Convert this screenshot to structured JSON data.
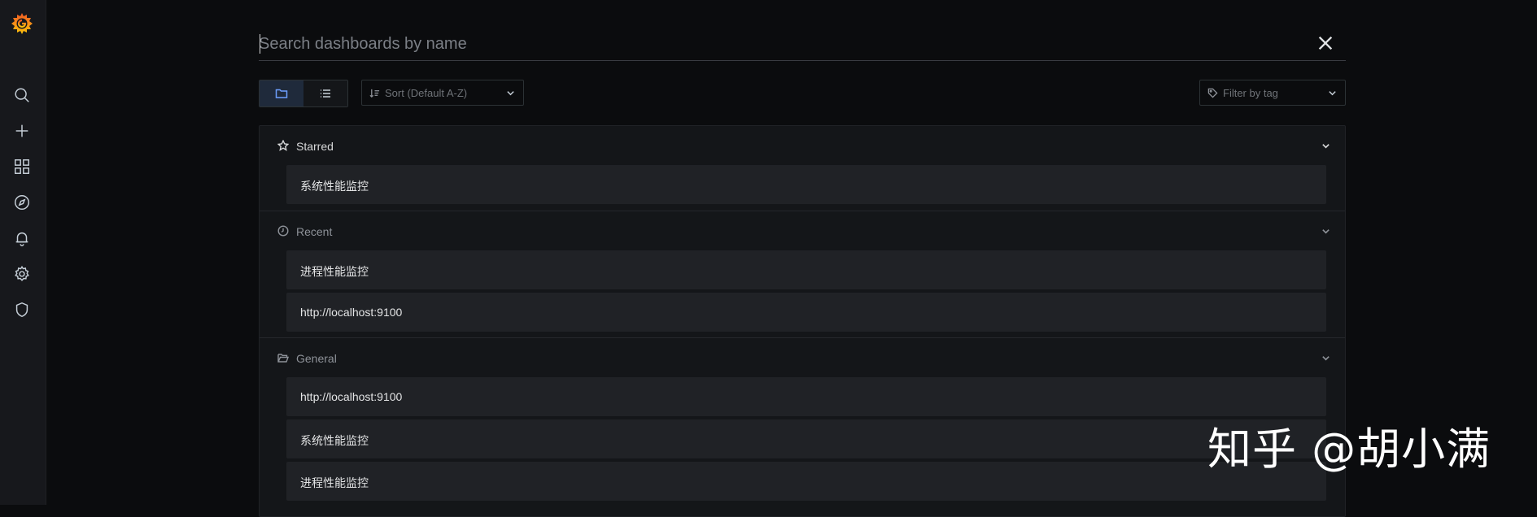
{
  "search": {
    "placeholder": "Search dashboards by name",
    "value": ""
  },
  "toolbar": {
    "sort_placeholder": "Sort (Default A-Z)",
    "tag_filter_placeholder": "Filter by tag",
    "active_view": "folders"
  },
  "sidebar": {
    "items": [
      {
        "icon": "search-icon"
      },
      {
        "icon": "plus-icon"
      },
      {
        "icon": "dashboards-grid-icon"
      },
      {
        "icon": "compass-icon"
      },
      {
        "icon": "bell-icon"
      },
      {
        "icon": "gear-icon"
      },
      {
        "icon": "shield-icon"
      }
    ]
  },
  "sections": [
    {
      "title": "Starred",
      "icon": "star-icon",
      "items": [
        "系统性能监控"
      ]
    },
    {
      "title": "Recent",
      "icon": "clock-icon",
      "items": [
        "进程性能监控",
        "http://localhost:9100"
      ]
    },
    {
      "title": "General",
      "icon": "folder-open-icon",
      "items": [
        "http://localhost:9100",
        "系统性能监控",
        "进程性能监控"
      ]
    }
  ],
  "watermark": "知乎 @胡小满",
  "colors": {
    "background": "#0b0c0e",
    "sidebar": "#17181c",
    "panel": "#141619",
    "item": "#202226",
    "accent": "#6e9fff",
    "logo_orange": "#f46800"
  }
}
